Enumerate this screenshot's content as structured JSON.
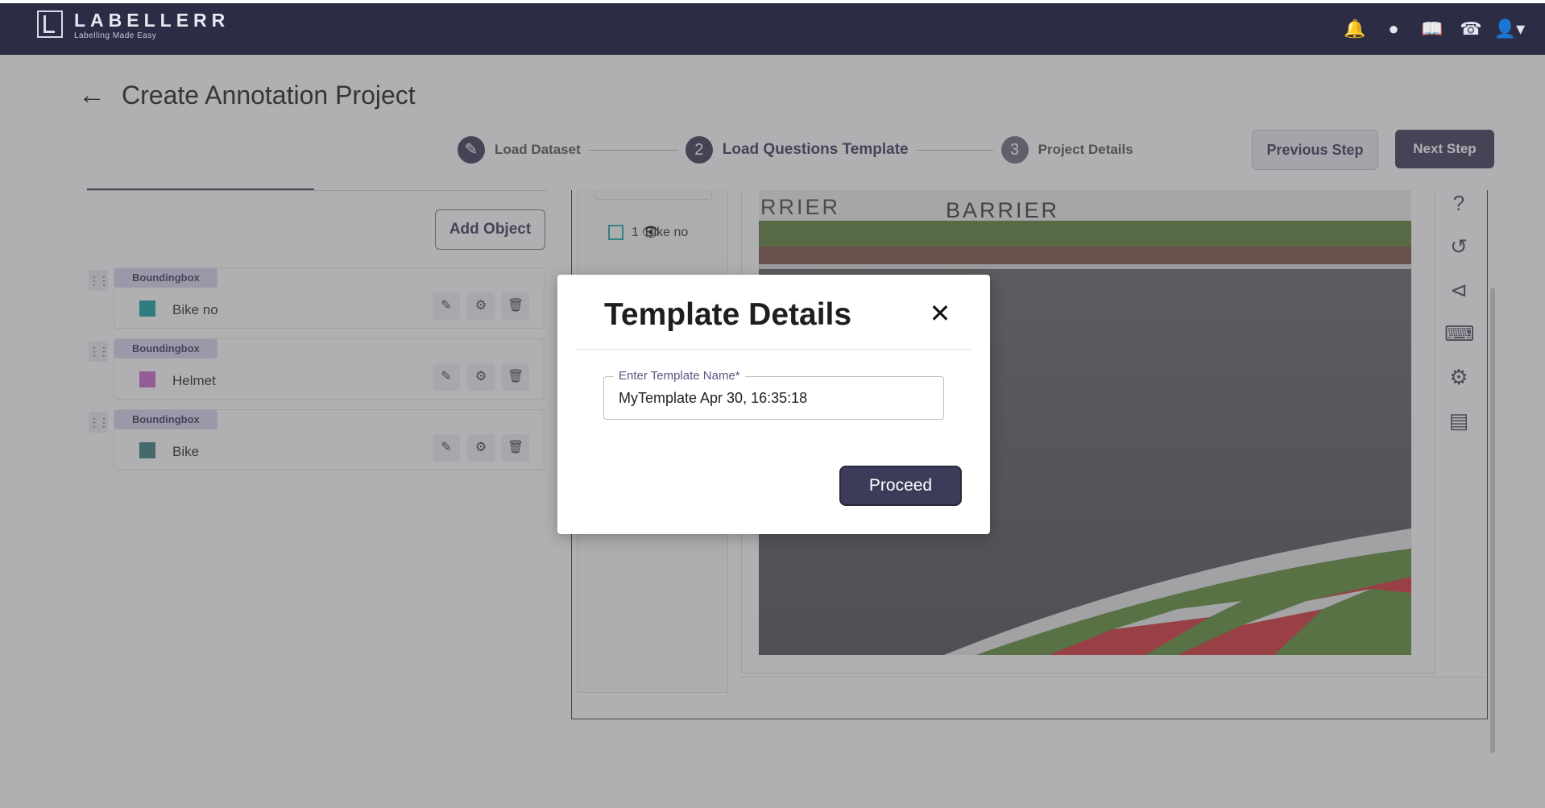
{
  "app": {
    "name": "LABELLERR",
    "tagline": "Labelling Made Easy",
    "top_icons": [
      "bell-icon",
      "team-icon",
      "book-icon",
      "support-icon",
      "user-icon"
    ]
  },
  "header": {
    "back_icon": "arrow-left-icon",
    "title": "Create Annotation Project"
  },
  "stepper": {
    "steps": [
      {
        "number": "",
        "icon": "pencil-icon",
        "label": "Load Dataset",
        "state": "done"
      },
      {
        "number": "2",
        "label": "Load Questions Template",
        "state": "active"
      },
      {
        "number": "3",
        "label": "Project Details",
        "state": "upcoming"
      }
    ]
  },
  "actions": {
    "previous_label": "Previous Step",
    "next_label": "Next Step"
  },
  "objects_panel": {
    "add_object_label": "Add Object",
    "items": [
      {
        "type": "Boundingbox",
        "label": "Bike no",
        "color": "#16a3a3"
      },
      {
        "type": "Boundingbox",
        "label": "Helmet",
        "color": "#c866c8"
      },
      {
        "type": "Boundingbox",
        "label": "Bike",
        "color": "#3f7f7f"
      }
    ]
  },
  "annotation_list": {
    "item_number": "1",
    "item_label": "Bike no"
  },
  "image": {
    "barrier_text_1": "RRIER",
    "barrier_text_2": "BARRIER"
  },
  "right_tools": [
    "help-icon",
    "history-icon",
    "share-icon",
    "keyboard-icon",
    "settings-icon",
    "pdf-icon"
  ],
  "modal": {
    "title": "Template Details",
    "field_label": "Enter Template Name*",
    "field_value": "MyTemplate Apr 30, 16:35:18",
    "proceed_label": "Proceed"
  },
  "colors": {
    "topbar": "#2c2c44",
    "primary": "#3c3b5a",
    "badge_bg": "#d9d6ef"
  }
}
